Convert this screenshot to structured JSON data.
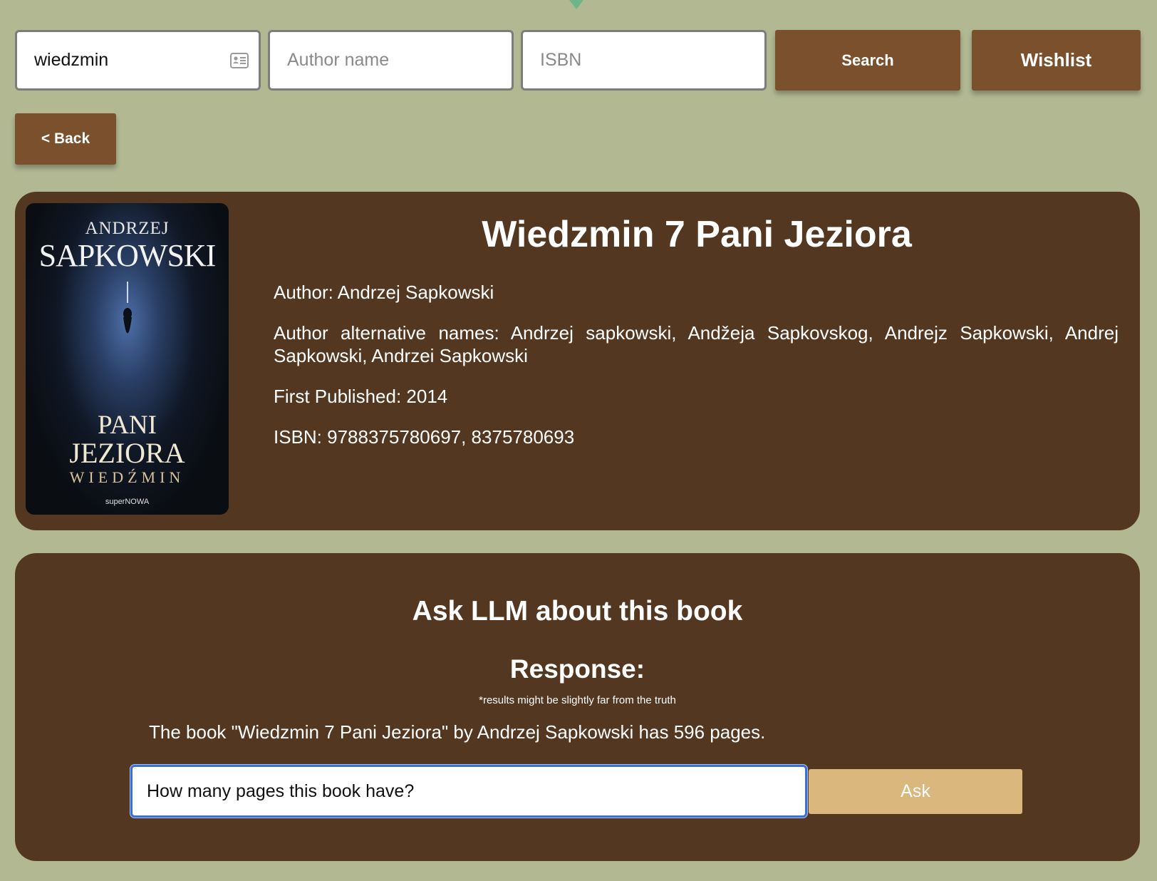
{
  "search": {
    "title_value": "wiedzmin",
    "author_placeholder": "Author name",
    "isbn_placeholder": "ISBN",
    "search_label": "Search",
    "wishlist_label": "Wishlist"
  },
  "nav": {
    "back_label": "< Back"
  },
  "book": {
    "title": "Wiedzmin 7 Pani Jeziora",
    "author": "Author: Andrzej Sapkowski",
    "alt_names": "Author alternative names: Andrzej sapkowski, Andžeja Sapkovskog, Andrejz Sapkowski, Andrej Sapkowski, Andrzei Sapkowski",
    "first_published": "First Published: 2014",
    "isbn": "ISBN: 9788375780697, 8375780693",
    "cover": {
      "author_first": "ANDRZEJ",
      "author_last": "SAPKOWSKI",
      "title_line1": "PANI",
      "title_line2": "JEZIORA",
      "series": "WIEDŹMIN",
      "publisher": "superNOWA"
    }
  },
  "llm": {
    "heading": "Ask LLM about this book",
    "response_heading": "Response:",
    "disclaimer": "*results might be slightly far from the truth",
    "response_text": "The book \"Wiedzmin 7 Pani Jeziora\" by Andrzej Sapkowski has 596 pages.",
    "question_value": "How many pages this book have?",
    "ask_label": "Ask"
  },
  "colors": {
    "background": "#b1b892",
    "card": "#533720",
    "button": "#7a512c",
    "ask_button": "#dab77d",
    "focus_border": "#3a6fd8"
  },
  "icons": {
    "title_field_icon": "contact-card-icon",
    "top_marker": "triangle-down-icon"
  }
}
